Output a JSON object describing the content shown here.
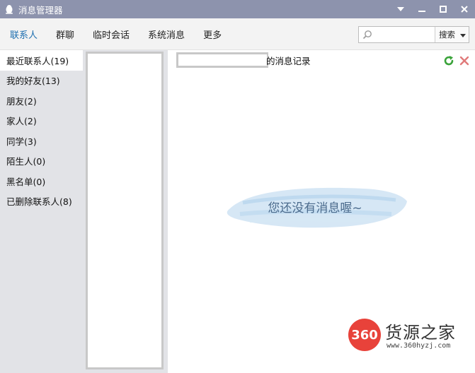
{
  "window": {
    "title": "消息管理器",
    "icon": "qq-penguin-icon",
    "controls": [
      "dropdown-arrow-icon",
      "minimize-icon",
      "maximize-icon",
      "close-icon"
    ]
  },
  "toolbar": {
    "tabs": [
      {
        "label": "联系人",
        "active": true
      },
      {
        "label": "群聊",
        "active": false
      },
      {
        "label": "临时会话",
        "active": false
      },
      {
        "label": "系统消息",
        "active": false
      },
      {
        "label": "更多",
        "active": false
      }
    ],
    "search": {
      "placeholder": "",
      "value": "",
      "mode_label": "搜索"
    }
  },
  "groups": {
    "items": [
      {
        "label": "最近联系人(19)",
        "selected": true
      },
      {
        "label": "我的好友(13)",
        "selected": false
      },
      {
        "label": "朋友(2)",
        "selected": false
      },
      {
        "label": "家人(2)",
        "selected": false
      },
      {
        "label": "同学(3)",
        "selected": false
      },
      {
        "label": "陌生人(0)",
        "selected": false
      },
      {
        "label": "黑名单(0)",
        "selected": false
      },
      {
        "label": "已删除联系人(8)",
        "selected": false
      }
    ]
  },
  "main": {
    "record_suffix": "的消息记录",
    "empty_message": "您还没有消息喔~",
    "actions": [
      "refresh-icon",
      "delete-icon"
    ]
  },
  "watermark": {
    "badge": "360",
    "name": "货源之家",
    "url": "www.360hyzj.com"
  },
  "colors": {
    "titlebar": "#8d93ad",
    "active_tab": "#1e6fb0",
    "sidebar": "#e2e3e7",
    "empty_text": "#4a6a8c",
    "refresh_green": "#3aa33a",
    "delete_red": "#e07a7a",
    "watermark_red": "#e8423a"
  }
}
